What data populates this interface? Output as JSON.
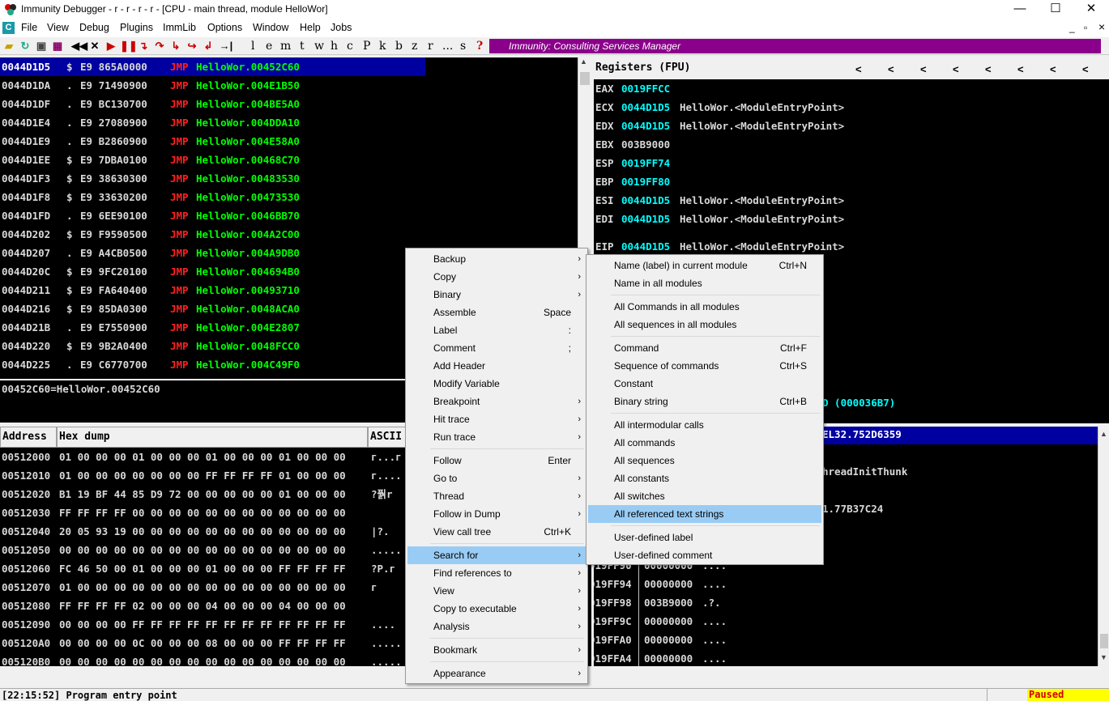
{
  "window": {
    "title": "Immunity Debugger - r - r - r - r  - [CPU - main thread, module HelloWor]",
    "min": "—",
    "max": "☐",
    "close": "✕",
    "mdi_min": "_",
    "mdi_restore": "▫",
    "mdi_close": "×"
  },
  "menubar": [
    "File",
    "View",
    "Debug",
    "Plugins",
    "ImmLib",
    "Options",
    "Window",
    "Help",
    "Jobs"
  ],
  "toolbar": {
    "letters": [
      "l",
      "e",
      "m",
      "t",
      "w",
      "h",
      "c",
      "P",
      "k",
      "b",
      "z",
      "r",
      "...",
      "s",
      "?"
    ],
    "banner": "Immunity: Consulting Services Manager"
  },
  "disasm": [
    {
      "addr": "0044D1D5",
      "m": "$",
      "hex": "E9 865A0000",
      "op": "JMP",
      "arg": "HelloWor.00452C60"
    },
    {
      "addr": "0044D1DA",
      "m": ".",
      "hex": "E9 71490900",
      "op": "JMP",
      "arg": "HelloWor.004E1B50"
    },
    {
      "addr": "0044D1DF",
      "m": ".",
      "hex": "E9 BC130700",
      "op": "JMP",
      "arg": "HelloWor.004BE5A0"
    },
    {
      "addr": "0044D1E4",
      "m": ".",
      "hex": "E9 27080900",
      "op": "JMP",
      "arg": "HelloWor.004DDA10"
    },
    {
      "addr": "0044D1E9",
      "m": ".",
      "hex": "E9 B2860900",
      "op": "JMP",
      "arg": "HelloWor.004E58A0"
    },
    {
      "addr": "0044D1EE",
      "m": "$",
      "hex": "E9 7DBA0100",
      "op": "JMP",
      "arg": "HelloWor.00468C70"
    },
    {
      "addr": "0044D1F3",
      "m": "$",
      "hex": "E9 38630300",
      "op": "JMP",
      "arg": "HelloWor.00483530"
    },
    {
      "addr": "0044D1F8",
      "m": "$",
      "hex": "E9 33630200",
      "op": "JMP",
      "arg": "HelloWor.00473530"
    },
    {
      "addr": "0044D1FD",
      "m": ".",
      "hex": "E9 6EE90100",
      "op": "JMP",
      "arg": "HelloWor.0046BB70"
    },
    {
      "addr": "0044D202",
      "m": "$",
      "hex": "E9 F9590500",
      "op": "JMP",
      "arg": "HelloWor.004A2C00"
    },
    {
      "addr": "0044D207",
      "m": ".",
      "hex": "E9 A4CB0500",
      "op": "JMP",
      "arg": "HelloWor.004A9DB0"
    },
    {
      "addr": "0044D20C",
      "m": "$",
      "hex": "E9 9FC20100",
      "op": "JMP",
      "arg": "HelloWor.004694B0"
    },
    {
      "addr": "0044D211",
      "m": "$",
      "hex": "E9 FA640400",
      "op": "JMP",
      "arg": "HelloWor.00493710"
    },
    {
      "addr": "0044D216",
      "m": "$",
      "hex": "E9 85DA0300",
      "op": "JMP",
      "arg": "HelloWor.0048ACA0"
    },
    {
      "addr": "0044D21B",
      "m": ".",
      "hex": "E9 E7550900",
      "op": "JMP",
      "arg": "HelloWor.004E2807"
    },
    {
      "addr": "0044D220",
      "m": "$",
      "hex": "E9 9B2A0400",
      "op": "JMP",
      "arg": "HelloWor.0048FCC0"
    },
    {
      "addr": "0044D225",
      "m": ".",
      "hex": "E9 C6770700",
      "op": "JMP",
      "arg": "HelloWor.004C49F0"
    }
  ],
  "info_line": "00452C60=HelloWor.00452C60",
  "registers": {
    "title": "Registers (FPU)",
    "arrows": [
      "<",
      "<",
      "<",
      "<",
      "<",
      "<",
      "<",
      "<"
    ],
    "rows": [
      {
        "r": "EAX",
        "v": "0019FFCC",
        "c": ""
      },
      {
        "r": "ECX",
        "v": "0044D1D5",
        "c": "HelloWor.<ModuleEntryPoint>"
      },
      {
        "r": "EDX",
        "v": "0044D1D5",
        "c": "HelloWor.<ModuleEntryPoint>"
      },
      {
        "r": "EBX",
        "v": "003B9000",
        "c": ""
      },
      {
        "r": "ESP",
        "v": "0019FF74",
        "c": ""
      },
      {
        "r": "EBP",
        "v": "0019FF80",
        "c": ""
      },
      {
        "r": "ESI",
        "v": "0044D1D5",
        "c": "HelloWor.<ModuleEntryPoint>"
      },
      {
        "r": "EDI",
        "v": "0044D1D5",
        "c": "HelloWor.<ModuleEntryPoint>"
      }
    ],
    "eip": {
      "r": "EIP",
      "v": "0044D1D5",
      "c": "HelloWor.<ModuleEntryPoint>"
    },
    "partial": "D (000036B7)"
  },
  "dump": {
    "col_address": "Address",
    "col_hex": "Hex dump",
    "col_ascii": "ASCII",
    "rows": [
      {
        "a": "00512000",
        "h": "01 00 00 00 01 00 00 00 01 00 00 00 01 00 00 00",
        "t": "г...г"
      },
      {
        "a": "00512010",
        "h": "01 00 00 00 00 00 00 00 FF FF FF FF 01 00 00 00",
        "t": "г...."
      },
      {
        "a": "00512020",
        "h": "B1 19 BF 44 85 D9 72 00 00 00 00 00 01 00 00 00",
        "t": "?풝r"
      },
      {
        "a": "00512030",
        "h": "FF FF FF FF 00 00 00 00 00 00 00 00 00 00 00 00",
        "t": ""
      },
      {
        "a": "00512040",
        "h": "20 05 93 19 00 00 00 00 00 00 00 00 00 00 00 00",
        "t": " |?."
      },
      {
        "a": "00512050",
        "h": "00 00 00 00 00 00 00 00 00 00 00 00 00 00 00 00",
        "t": "....."
      },
      {
        "a": "00512060",
        "h": "FC 46 50 00 01 00 00 00 01 00 00 00 FF FF FF FF",
        "t": "?P.г"
      },
      {
        "a": "00512070",
        "h": "01 00 00 00 00 00 00 00 00 00 00 00 00 00 00 00",
        "t": "г"
      },
      {
        "a": "00512080",
        "h": "FF FF FF FF 02 00 00 00 04 00 00 00 04 00 00 00",
        "t": ""
      },
      {
        "a": "00512090",
        "h": "00 00 00 00 FF FF FF FF FF FF FF FF FF FF FF FF",
        "t": "...."
      },
      {
        "a": "005120A0",
        "h": "00 00 00 00 0C 00 00 00 08 00 00 00 FF FF FF FF",
        "t": "....."
      },
      {
        "a": "005120B0",
        "h": "00 00 00 00 00 00 00 00 00 00 00 00 00 00 00 00",
        "t": "....."
      }
    ]
  },
  "stack": {
    "header": "EL32.752D6359",
    "partial": [
      "hreadInitThunk",
      "1.77B37C24"
    ],
    "rows": [
      {
        "a": "019FF90",
        "v": "00000000",
        "t": "...."
      },
      {
        "a": "019FF94",
        "v": "00000000",
        "t": "...."
      },
      {
        "a": "019FF98",
        "v": "003B9000",
        "t": ".?."
      },
      {
        "a": "019FF9C",
        "v": "00000000",
        "t": "...."
      },
      {
        "a": "019FFA0",
        "v": "00000000",
        "t": "...."
      },
      {
        "a": "019FFA4",
        "v": "00000000",
        "t": "...."
      }
    ]
  },
  "context_menu": [
    {
      "label": "Backup",
      "sc": "",
      "arrow": true
    },
    {
      "label": "Copy",
      "sc": "",
      "arrow": true
    },
    {
      "label": "Binary",
      "sc": "",
      "arrow": true
    },
    {
      "label": "Assemble",
      "sc": "Space",
      "arrow": false
    },
    {
      "label": "Label",
      "sc": ":",
      "arrow": false
    },
    {
      "label": "Comment",
      "sc": ";",
      "arrow": false
    },
    {
      "label": "Add Header",
      "sc": "",
      "arrow": false
    },
    {
      "label": "Modify Variable",
      "sc": "",
      "arrow": false
    },
    {
      "label": "Breakpoint",
      "sc": "",
      "arrow": true
    },
    {
      "label": "Hit trace",
      "sc": "",
      "arrow": true
    },
    {
      "label": "Run trace",
      "sc": "",
      "arrow": true
    },
    {
      "label": "Follow",
      "sc": "Enter",
      "arrow": false
    },
    {
      "label": "Go to",
      "sc": "",
      "arrow": true
    },
    {
      "label": "Thread",
      "sc": "",
      "arrow": true
    },
    {
      "label": "Follow in Dump",
      "sc": "",
      "arrow": true
    },
    {
      "label": "View call tree",
      "sc": "Ctrl+K",
      "arrow": false
    },
    {
      "label": "Search for",
      "sc": "",
      "arrow": true
    },
    {
      "label": "Find references to",
      "sc": "",
      "arrow": true
    },
    {
      "label": "View",
      "sc": "",
      "arrow": true
    },
    {
      "label": "Copy to executable",
      "sc": "",
      "arrow": true
    },
    {
      "label": "Analysis",
      "sc": "",
      "arrow": true
    },
    {
      "label": "Bookmark",
      "sc": "",
      "arrow": true
    },
    {
      "label": "Appearance",
      "sc": "",
      "arrow": true
    }
  ],
  "submenu": [
    {
      "label": "Name (label) in current module",
      "sc": "Ctrl+N"
    },
    {
      "label": "Name in all modules",
      "sc": ""
    },
    {
      "label": "All Commands in all modules",
      "sc": ""
    },
    {
      "label": "All sequences in all modules",
      "sc": ""
    },
    {
      "label": "Command",
      "sc": "Ctrl+F"
    },
    {
      "label": "Sequence of commands",
      "sc": "Ctrl+S"
    },
    {
      "label": "Constant",
      "sc": ""
    },
    {
      "label": "Binary string",
      "sc": "Ctrl+B"
    },
    {
      "label": "All intermodular calls",
      "sc": ""
    },
    {
      "label": "All commands",
      "sc": ""
    },
    {
      "label": "All sequences",
      "sc": ""
    },
    {
      "label": "All constants",
      "sc": ""
    },
    {
      "label": "All switches",
      "sc": ""
    },
    {
      "label": "All referenced text strings",
      "sc": ""
    },
    {
      "label": "User-defined label",
      "sc": ""
    },
    {
      "label": "User-defined comment",
      "sc": ""
    }
  ],
  "status": {
    "message": "[22:15:52] Program entry point",
    "state": "Paused",
    "state_color": "#ffff00"
  }
}
